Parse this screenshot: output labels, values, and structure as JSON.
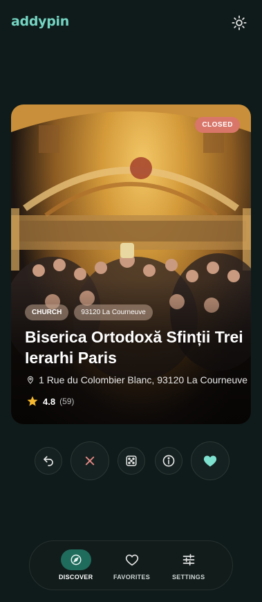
{
  "app": {
    "logo": "addypin"
  },
  "place": {
    "status": "CLOSED",
    "category": "CHURCH",
    "locality": "93120 La Courneuve",
    "title": "Biserica Ortodoxă Sfinții Trei Ierarhi Paris",
    "address": "1 Rue du Colombier Blanc, 93120 La Courneuve",
    "rating": "4.8",
    "review_count": "(59)"
  },
  "actions": [
    {
      "name": "undo",
      "icon": "undo-icon"
    },
    {
      "name": "dismiss",
      "icon": "close-icon"
    },
    {
      "name": "random",
      "icon": "dice-icon"
    },
    {
      "name": "info",
      "icon": "info-icon"
    },
    {
      "name": "like",
      "icon": "heart-icon"
    }
  ],
  "nav": {
    "discover": "DISCOVER",
    "favorites": "FAVORITES",
    "settings": "SETTINGS"
  },
  "colors": {
    "background": "#0f1b1a",
    "accent": "#74d4c2",
    "heart": "#7ee0cf",
    "closed_badge": "#d9766a",
    "active_nav": "#1f6b5c",
    "dismiss": "#e68a86"
  }
}
